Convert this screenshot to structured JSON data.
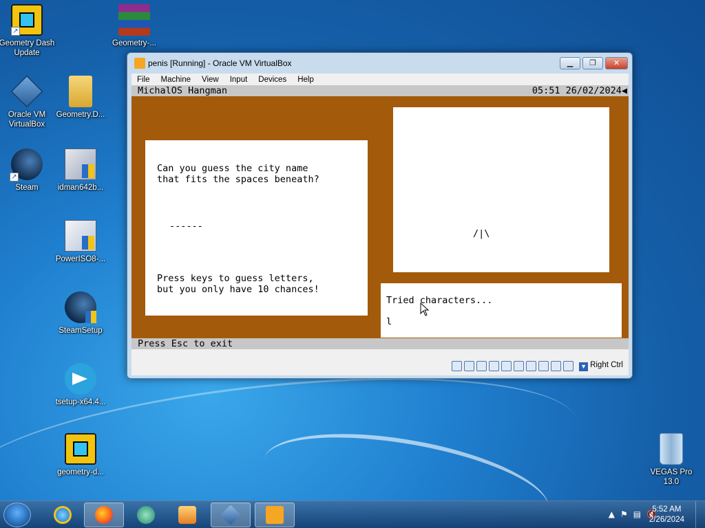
{
  "desktop": {
    "icons": [
      {
        "label": "Geometry Dash Update"
      },
      {
        "label": "Geometry-..."
      },
      {
        "label": "Oracle VM VirtualBox"
      },
      {
        "label": "Geometry.D..."
      },
      {
        "label": "Steam"
      },
      {
        "label": "idman642b..."
      },
      {
        "label": "PowerISO8-..."
      },
      {
        "label": "SteamSetup"
      },
      {
        "label": "tsetup-x64.4..."
      },
      {
        "label": "geometry-d..."
      },
      {
        "label": "VEGAS Pro 13.0"
      }
    ]
  },
  "window": {
    "title": "penis [Running] - Oracle VM VirtualBox",
    "menu": [
      "File",
      "Machine",
      "View",
      "Input",
      "Devices",
      "Help"
    ],
    "status_right": "Right Ctrl"
  },
  "guest": {
    "app_title": "MichalOS Hangman",
    "datetime": "05:51 26/02/2024",
    "question_line1": "Can you guess the city name",
    "question_line2": "that fits the spaces beneath?",
    "blanks": "------",
    "instr_line1": "Press keys to guess letters,",
    "instr_line2": "but you only have 10 chances!",
    "gallows_figure": "/|\\",
    "tried_label": "Tried characters...",
    "tried_chars": "l",
    "footer": "Press Esc to exit"
  },
  "taskbar": {
    "time": "5:52 AM",
    "date": "2/26/2024"
  },
  "colors": {
    "guest_bg": "#a35a0a",
    "guest_bar": "#c7c7c7"
  }
}
